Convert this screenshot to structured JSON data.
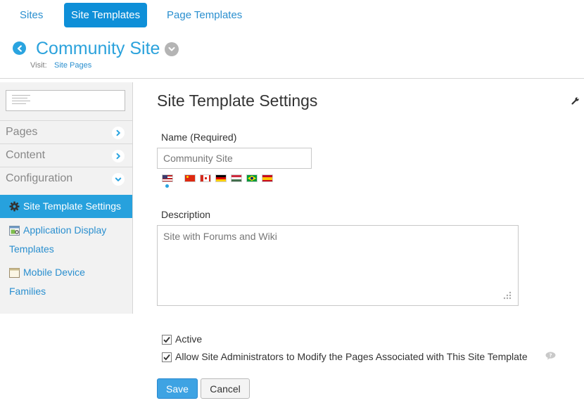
{
  "tabs": [
    {
      "label": "Sites",
      "active": false
    },
    {
      "label": "Site Templates",
      "active": true
    },
    {
      "label": "Page Templates",
      "active": false
    }
  ],
  "header": {
    "title": "Community Site",
    "visit_label": "Visit:",
    "visit_link": "Site Pages"
  },
  "sidebar": {
    "sections": [
      {
        "label": "Pages",
        "state": "collapsed"
      },
      {
        "label": "Content",
        "state": "collapsed"
      },
      {
        "label": "Configuration",
        "state": "expanded"
      }
    ],
    "active_item": "Site Template Settings",
    "links": [
      {
        "line1": "Application Display",
        "line2": "Templates",
        "icon": "application-display-templates-icon"
      },
      {
        "line1": "Mobile Device",
        "line2": "Families",
        "icon": "mobile-device-families-icon"
      }
    ]
  },
  "form": {
    "title": "Site Template Settings",
    "name_label": "Name (Required)",
    "name_value": "Community Site",
    "language_flags": [
      "flag-us-icon",
      "flag-cn-icon",
      "flag-ca-icon",
      "flag-de-icon",
      "flag-hu-icon",
      "flag-br-icon",
      "flag-es-icon"
    ],
    "description_label": "Description",
    "description_value": "Site with Forums and Wiki",
    "active_label": "Active",
    "active_checked": true,
    "allow_label": "Allow Site Administrators to Modify the Pages Associated with This Site Template",
    "allow_checked": true
  },
  "buttons": {
    "save": "Save",
    "cancel": "Cancel"
  },
  "colors": {
    "accent": "#0e8fd8",
    "link": "#2a8fcf",
    "title_blue": "#2ba2dc",
    "sidebar_active": "#27a1dd"
  }
}
